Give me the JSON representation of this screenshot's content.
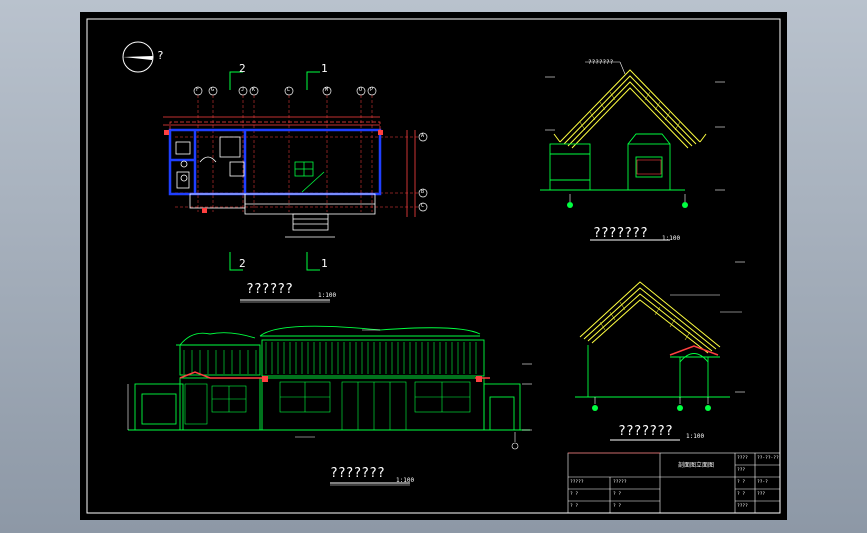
{
  "window": {
    "background": "#9aa4b1",
    "canvas_background": "#000000"
  },
  "colors": {
    "frame": "#ffffff",
    "wall": "#1f3fff",
    "structure": "#00ff40",
    "roof": "#ffff40",
    "dim": "#ff4040",
    "text": "#ffffff",
    "marker": "#00ff40"
  },
  "compass": {
    "label": "?"
  },
  "plan": {
    "title": "??????",
    "scale": "1:100",
    "section_1": "1",
    "section_2": "2",
    "grid_top": [
      "F",
      "G",
      "J",
      "K",
      "L",
      "M",
      "O",
      "P"
    ],
    "grid_right": [
      "A",
      "B",
      "C"
    ]
  },
  "side_elevation": {
    "title": "???????",
    "scale": "1:100",
    "roof_note": "???????"
  },
  "section": {
    "title": "???????",
    "scale": "1:100"
  },
  "front_elevation": {
    "title": "???????",
    "scale": "1:100"
  },
  "title_block": {
    "drawing_name": "剖面图立面图",
    "rows_left": [
      [
        "?????",
        "?????"
      ],
      [
        "? ?",
        "? ?"
      ],
      [
        "? ?",
        "? ?"
      ]
    ],
    "rows_right": [
      [
        "????",
        "??-??-??"
      ],
      [
        "???",
        ""
      ],
      [
        "? ?",
        "??-?"
      ],
      [
        "? ?",
        "???"
      ],
      [
        "????",
        ""
      ]
    ]
  }
}
